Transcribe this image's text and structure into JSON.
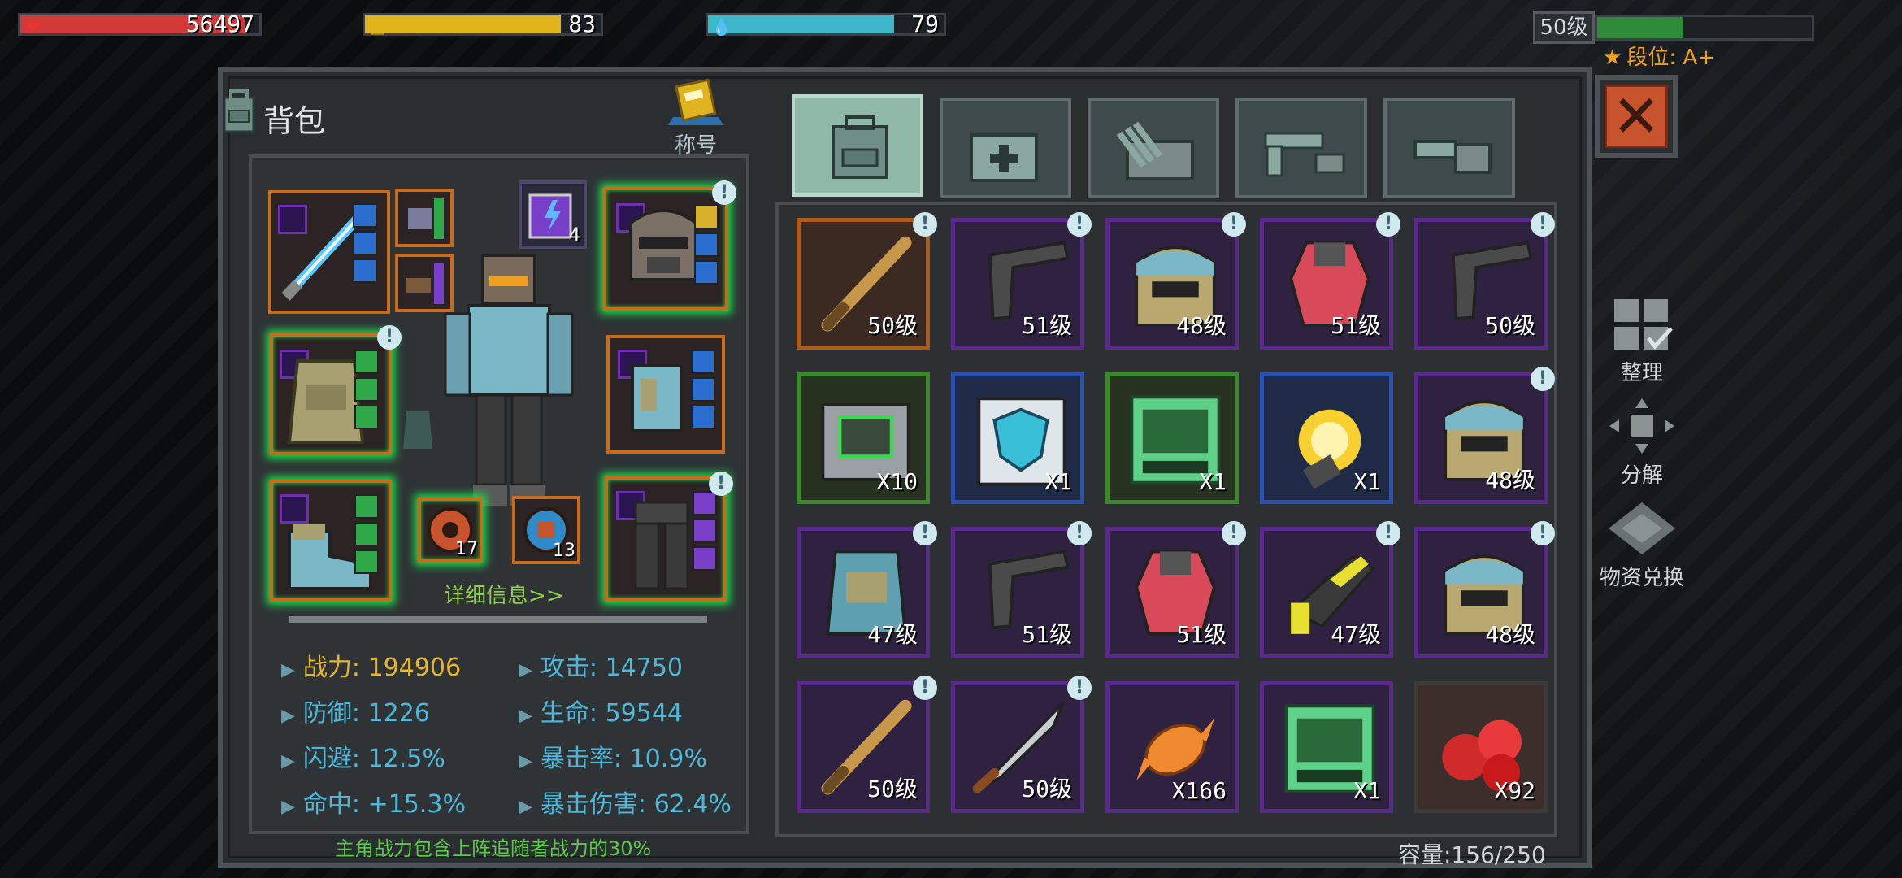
{
  "hud": {
    "hp": {
      "value": "56497",
      "fill": 0.94,
      "color": "#d23a3a"
    },
    "energy": {
      "value": "83",
      "fill": 0.83,
      "color": "#e0b41e"
    },
    "water": {
      "value": "79",
      "fill": 0.79,
      "color": "#3eb7c8"
    },
    "level_label": "50级",
    "xp_fill": 0.4,
    "rank_label": "段位: A+"
  },
  "backpack": {
    "title": "背包",
    "title_badge_label": "称号",
    "detail_link": "详细信息>>",
    "mini_counts": {
      "battery": "4",
      "chip1": "17",
      "chip2": "13"
    },
    "stats": [
      {
        "label": "战力: 194906",
        "gold": true
      },
      {
        "label": "攻击: 14750",
        "gold": false
      },
      {
        "label": "防御: 1226",
        "gold": false
      },
      {
        "label": "生命: 59544",
        "gold": false
      },
      {
        "label": "闪避: 12.5%",
        "gold": false
      },
      {
        "label": "暴击率: 10.9%",
        "gold": false
      },
      {
        "label": "命中: +15.3%",
        "gold": false
      },
      {
        "label": "暴击伤害: 62.4%",
        "gold": false
      }
    ],
    "footnote": "主角战力包含上阵追随者战力的30%"
  },
  "tabs": [
    {
      "name": "backpack-icon",
      "active": true
    },
    {
      "name": "medkit-icon",
      "active": false
    },
    {
      "name": "materials-icon",
      "active": false
    },
    {
      "name": "gun-icon",
      "active": false
    },
    {
      "name": "tools-icon",
      "active": false
    }
  ],
  "items": [
    {
      "icon": "baseball-bat-icon",
      "frame": "orange",
      "label": "50级",
      "info": true
    },
    {
      "icon": "pistol-icon",
      "frame": "purple",
      "label": "51级",
      "info": true
    },
    {
      "icon": "helmet-icon",
      "frame": "purple",
      "label": "48级",
      "info": true
    },
    {
      "icon": "red-suit-icon",
      "frame": "purple",
      "label": "51级",
      "info": true
    },
    {
      "icon": "pistol-icon",
      "frame": "purple",
      "label": "50级",
      "info": true
    },
    {
      "icon": "container-icon",
      "frame": "green",
      "label": "X10",
      "info": false
    },
    {
      "icon": "shield-chip-icon",
      "frame": "blue",
      "label": "X1",
      "info": false
    },
    {
      "icon": "terminal-icon",
      "frame": "green",
      "label": "X1",
      "info": false
    },
    {
      "icon": "grenade-icon",
      "frame": "blue",
      "label": "X1",
      "info": false
    },
    {
      "icon": "helmet-icon",
      "frame": "purple",
      "label": "48级",
      "info": true
    },
    {
      "icon": "vest-icon",
      "frame": "purple",
      "label": "47级",
      "info": true
    },
    {
      "icon": "pistol-icon",
      "frame": "purple",
      "label": "51级",
      "info": true
    },
    {
      "icon": "red-suit-icon",
      "frame": "purple",
      "label": "51级",
      "info": true
    },
    {
      "icon": "blaster-icon",
      "frame": "purple",
      "label": "47级",
      "info": true
    },
    {
      "icon": "helmet-icon",
      "frame": "purple",
      "label": "48级",
      "info": true
    },
    {
      "icon": "baseball-bat-icon",
      "frame": "purple",
      "label": "50级",
      "info": true
    },
    {
      "icon": "machete-icon",
      "frame": "purple",
      "label": "50级",
      "info": true
    },
    {
      "icon": "candy-icon",
      "frame": "purple",
      "label": "X166",
      "info": false
    },
    {
      "icon": "terminal-icon",
      "frame": "purple",
      "label": "X1",
      "info": false
    },
    {
      "icon": "apples-icon",
      "frame": "plain",
      "label": "X92",
      "info": false
    }
  ],
  "side_buttons": {
    "sort": "整理",
    "dismantle": "分解",
    "exchange": "物资兑换"
  },
  "capacity": "容量:156/250"
}
